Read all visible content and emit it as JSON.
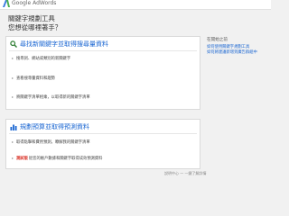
{
  "app": {
    "logo_text": "Google AdWords",
    "brand_color": "#3a7be0"
  },
  "page": {
    "heading_line1": "關鍵字規劃工具",
    "heading_line2": "您想從哪裡著手？"
  },
  "card_search": {
    "icon": "search-magnifier-icon",
    "title": "尋找新關鍵字並取得搜尋量資料",
    "options": [
      "搜尋詞、網站或類別的新關鍵字",
      "查看搜尋量資料和趨勢",
      "將關鍵字清單相乘，以取得新的關鍵字清單"
    ]
  },
  "card_plan": {
    "icon": "bar-chart-icon",
    "title": "規劃預算並取得預測資料",
    "options": [
      {
        "tag": "",
        "text": "取得點擊和費用預測，瞭解我的關鍵字清單"
      },
      {
        "tag": "測試版",
        "text": "從您的帳戶數據和關鍵字取得成效預測資料"
      }
    ]
  },
  "sidebar": {
    "title": "在開始之前",
    "links": [
      "如何使用關鍵字規劃工具",
      "如何將建議新增到廣告群組中"
    ]
  },
  "footer": {
    "text": "說明中心 — 一鍵了解詳情"
  }
}
